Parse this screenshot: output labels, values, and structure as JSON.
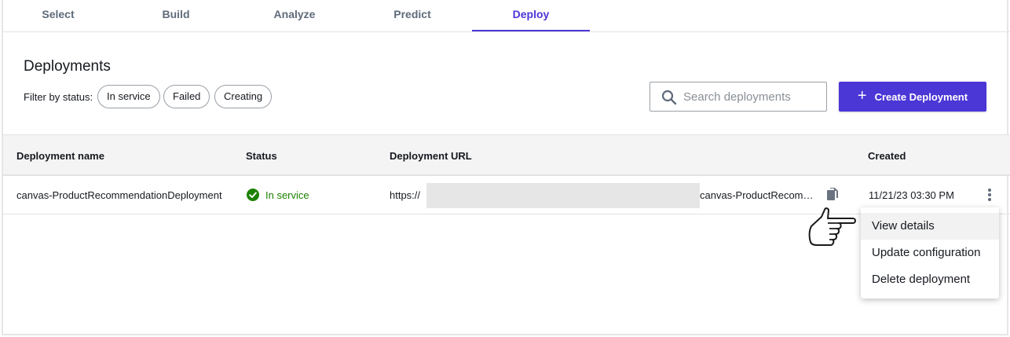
{
  "tabs": [
    {
      "label": "Select"
    },
    {
      "label": "Build"
    },
    {
      "label": "Analyze"
    },
    {
      "label": "Predict"
    },
    {
      "label": "Deploy",
      "active": true
    }
  ],
  "header": {
    "title": "Deployments",
    "filter_label": "Filter by status:",
    "filters": [
      "In service",
      "Failed",
      "Creating"
    ],
    "search_placeholder": "Search deployments",
    "create_label": "Create Deployment"
  },
  "table": {
    "columns": [
      "Deployment name",
      "Status",
      "Deployment URL",
      "Created"
    ],
    "rows": [
      {
        "name": "canvas-ProductRecommendationDeployment",
        "status": "In service",
        "url_prefix": "https://",
        "url_suffix": "canvas-ProductRecom…",
        "created": "11/21/23 03:30 PM"
      }
    ]
  },
  "row_menu": {
    "items": [
      "View details",
      "Update configuration",
      "Delete deployment"
    ]
  },
  "colors": {
    "accent": "#4b36d6",
    "success": "#1d8102",
    "header_bg": "#f4f4f4"
  },
  "icons": {
    "search": "search-icon",
    "plus": "plus-icon",
    "status": "check-circle-icon",
    "copy": "copy-icon",
    "more": "more-vertical-icon",
    "pointer": "pointing-hand-icon"
  }
}
